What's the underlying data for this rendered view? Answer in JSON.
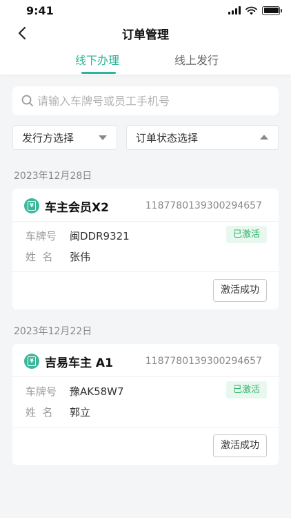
{
  "status_bar": {
    "time": "9:41"
  },
  "header": {
    "title": "订单管理"
  },
  "tabs": [
    {
      "label": "线下办理",
      "active": true
    },
    {
      "label": "线上发行",
      "active": false
    }
  ],
  "search": {
    "placeholder": "请输入车牌号或员工手机号",
    "value": ""
  },
  "filters": {
    "issuer": "发行方选择",
    "status": "订单状态选择"
  },
  "field_labels": {
    "plate": "车牌号",
    "name": "姓  名"
  },
  "orders": [
    {
      "date": "2023年12月28日",
      "title": "车主会员X2",
      "order_no": "1187780139300294657",
      "plate": "闽DDR9321",
      "name": "张伟",
      "badge": "已激活",
      "action": "激活成功"
    },
    {
      "date": "2023年12月22日",
      "title": "吉易车主 A1",
      "order_no": "1187780139300294657",
      "plate": "豫AK58W7",
      "name": "郭立",
      "badge": "已激活",
      "action": "激活成功"
    }
  ],
  "colors": {
    "accent": "#2fb39a",
    "badge_text": "#2fb36a",
    "badge_bg": "#e8f8ef"
  }
}
